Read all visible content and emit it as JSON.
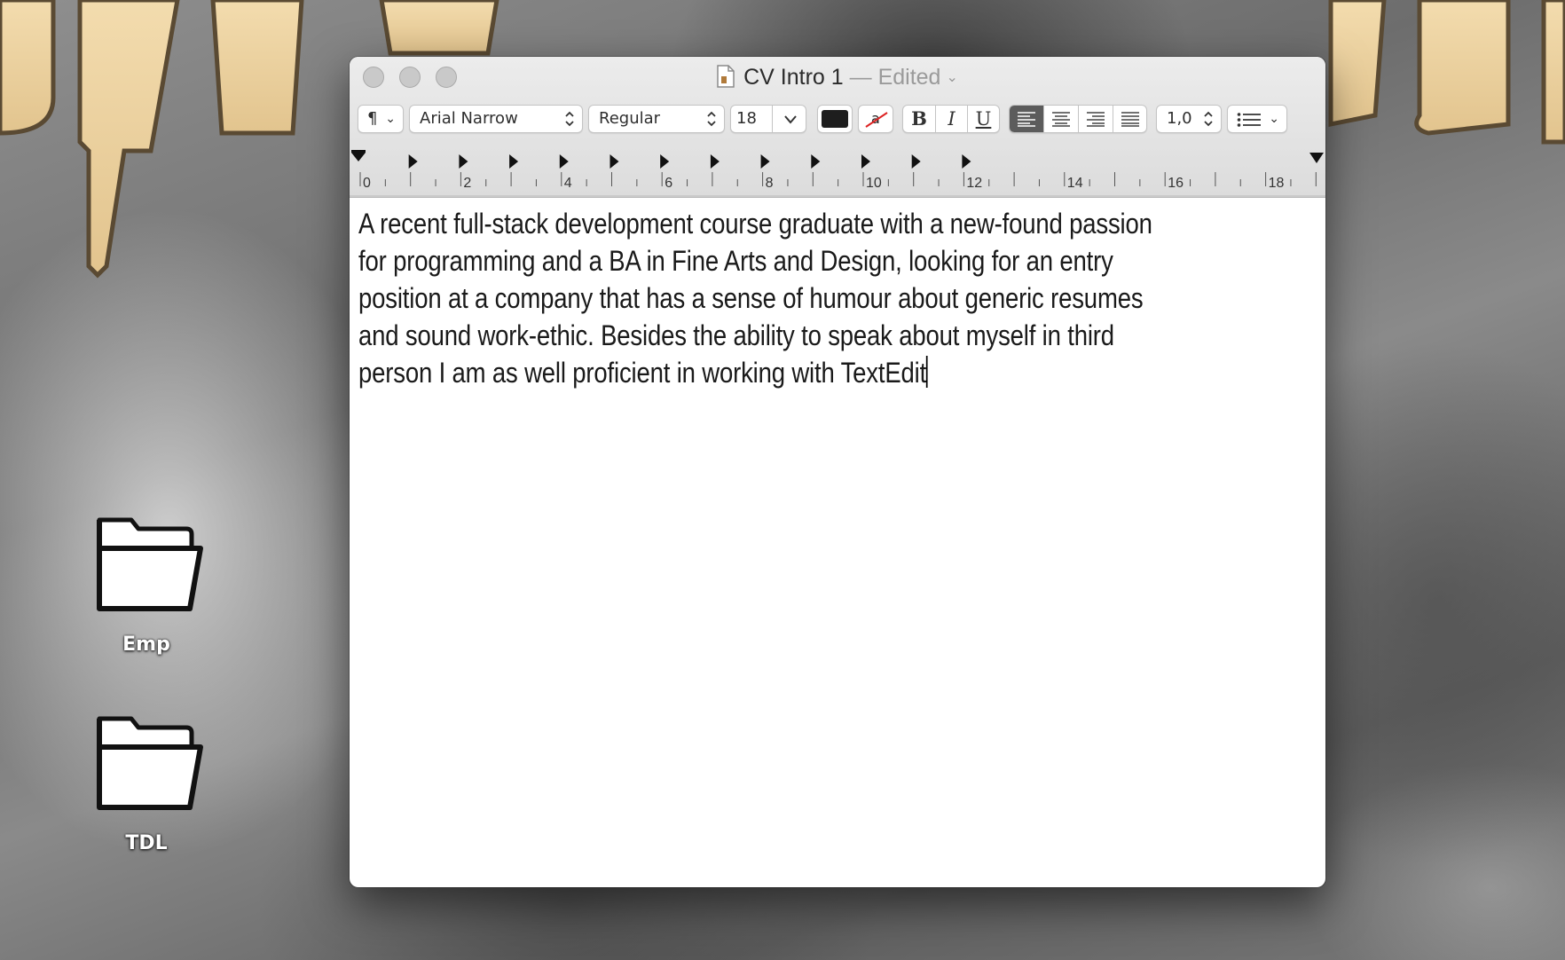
{
  "desktop": {
    "icons": [
      {
        "label": "Emp",
        "icon": "folder-icon"
      },
      {
        "label": "TDL",
        "icon": "folder-icon"
      }
    ]
  },
  "window": {
    "title": "CV Intro 1",
    "status": "— Edited",
    "toolbar": {
      "paragraph_styles": "¶",
      "font_family": "Arial Narrow",
      "font_style": "Regular",
      "font_size": "18",
      "bold": "B",
      "italic": "I",
      "underline": "U",
      "line_spacing": "1,0",
      "active_alignment": "left",
      "text_color": "#1e1e1e"
    },
    "ruler": {
      "labels": [
        "0",
        "2",
        "4",
        "6",
        "8",
        "10",
        "12",
        "14",
        "16",
        "18"
      ]
    },
    "document": {
      "text": "A recent full-stack development course graduate with a new-found passion for programming and a BA in Fine Arts and Design, looking for an entry position at a company that has a sense of humour about generic resumes and sound work-ethic. Besides the ability to speak about myself in third person I am as well proficient in working with TextEdit"
    }
  }
}
